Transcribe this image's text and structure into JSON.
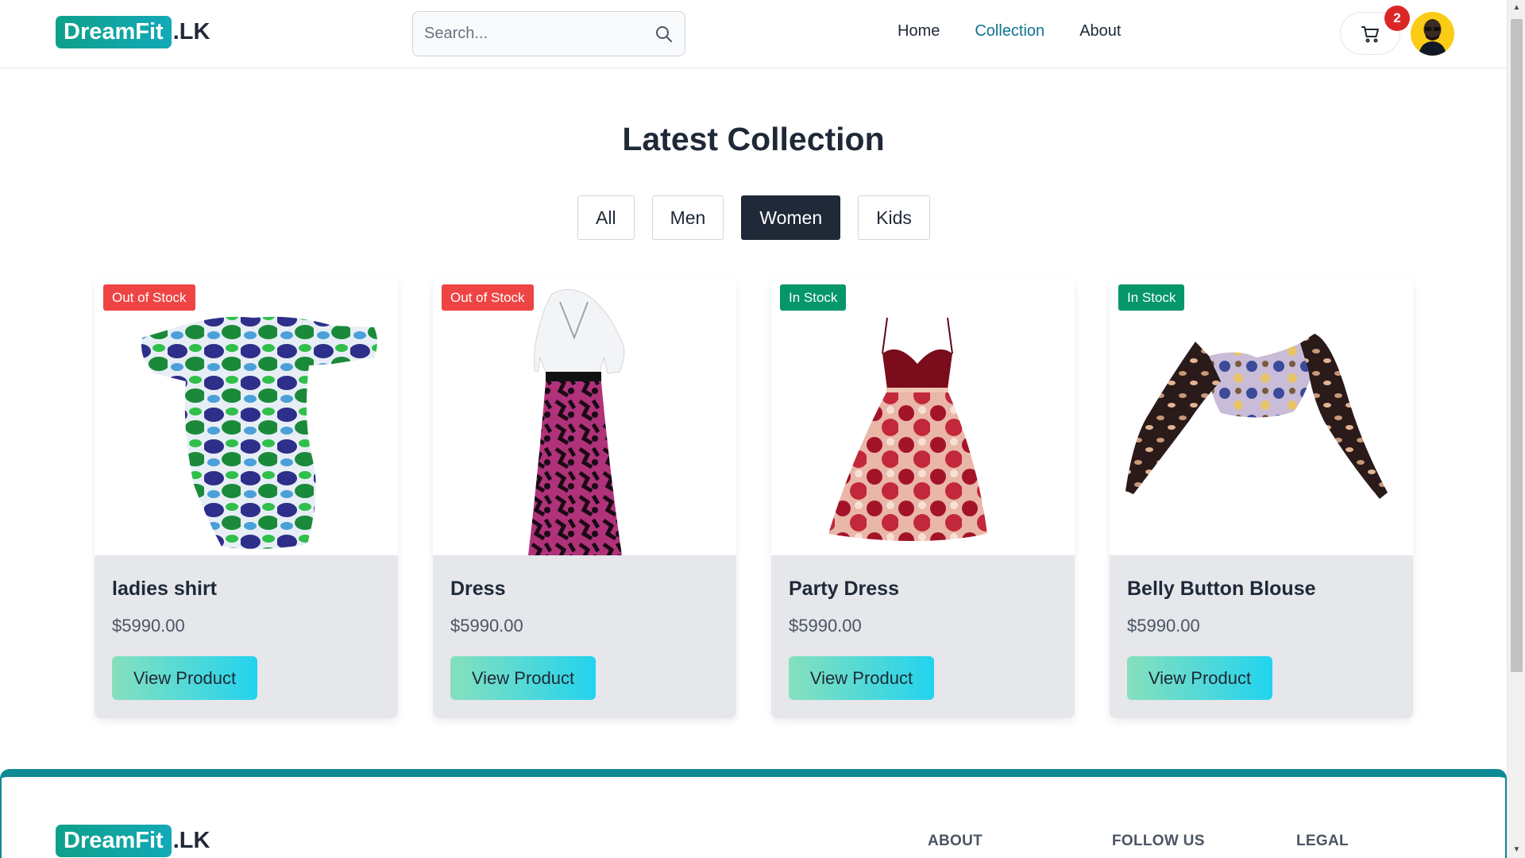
{
  "header": {
    "logo_badge": "DreamFit",
    "logo_suffix": ".LK",
    "search_placeholder": "Search...",
    "nav": [
      {
        "label": "Home"
      },
      {
        "label": "Collection"
      },
      {
        "label": "About"
      }
    ],
    "cart_count": "2"
  },
  "main": {
    "title": "Latest Collection",
    "filters": [
      "All",
      "Men",
      "Women",
      "Kids"
    ],
    "active_filter": "Women",
    "products": [
      {
        "stock": "Out of Stock",
        "name": "ladies shirt",
        "price": "$5990.00",
        "button": "View Product"
      },
      {
        "stock": "Out of Stock",
        "name": "Dress",
        "price": "$5990.00",
        "button": "View Product"
      },
      {
        "stock": "In Stock",
        "name": "Party Dress",
        "price": "$5990.00",
        "button": "View Product"
      },
      {
        "stock": "In Stock",
        "name": "Belly Button Blouse",
        "price": "$5990.00",
        "button": "View Product"
      }
    ]
  },
  "footer": {
    "logo_badge": "DreamFit",
    "logo_suffix": ".LK",
    "columns": [
      "ABOUT",
      "FOLLOW US",
      "LEGAL"
    ]
  },
  "colors": {
    "brand_teal": "#0ea08a",
    "accent": "#0e7490",
    "out_of_stock": "#ef4444",
    "in_stock": "#059669",
    "active_filter_bg": "#1f2937"
  },
  "icons": [
    "search-icon",
    "cart-icon",
    "avatar"
  ]
}
